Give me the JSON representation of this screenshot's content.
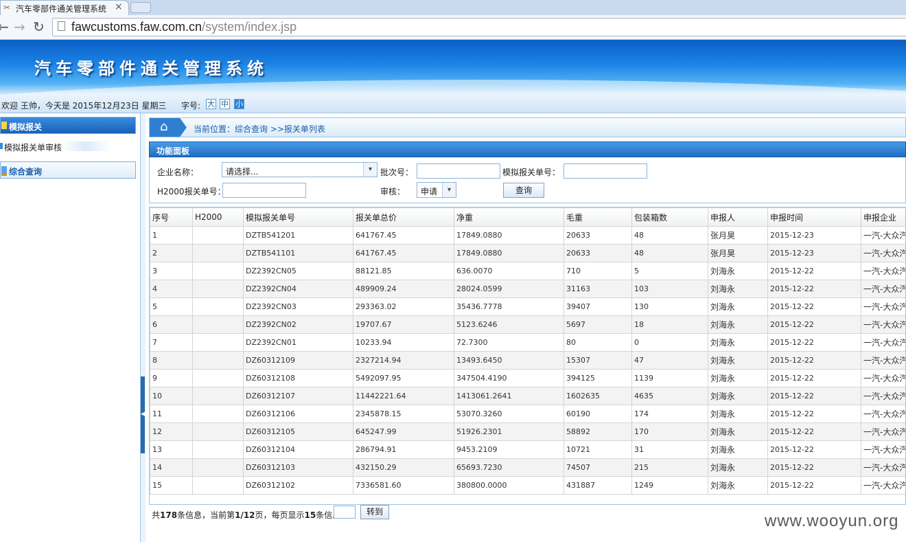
{
  "browser": {
    "tab_title": "汽车零部件通关管理系统",
    "tab_close": "×",
    "url_host": "fawcustoms.faw.com.cn",
    "url_path": "/system/index.jsp",
    "back_glyph": "←",
    "forward_glyph": "→",
    "reload_glyph": "↻"
  },
  "header": {
    "app_title": "汽车零部件通关管理系统",
    "welcome": "欢迎 王帅，今天是 2015年12月23日 星期三",
    "font_size_label": "字号:",
    "font_sizes": [
      "大",
      "中",
      "小"
    ]
  },
  "sidebar": {
    "sections": [
      {
        "label": "模拟报关",
        "items": [
          "模拟报关单审核"
        ]
      },
      {
        "label": "综合查询"
      }
    ]
  },
  "breadcrumb": {
    "text": "当前位置：综合查询 >>报关单列表",
    "home_glyph": "⌂"
  },
  "panel": {
    "title": "功能面板",
    "company_label": "企业名称：",
    "company_value": "请选择...",
    "batch_label": "批次号：",
    "batch_value": "",
    "mock_no_label": "模拟报关单号：",
    "mock_no_value": "",
    "h2000_label": "H2000报关单号：",
    "h2000_value": "",
    "audit_label": "审核：",
    "audit_value": "申请",
    "query_button": "查询",
    "dropdown_glyph": "▾"
  },
  "table": {
    "columns": [
      "序号",
      "H2000",
      "模拟报关单号",
      "报关单总价",
      "净重",
      "毛重",
      "包装箱数",
      "申报人",
      "申报时间",
      "申报企业"
    ],
    "rows": [
      [
        "1",
        "",
        "DZTB541201",
        "641767.45",
        "17849.0880",
        "20633",
        "48",
        "张月昊",
        "2015-12-23",
        "一汽-大众汽"
      ],
      [
        "2",
        "",
        "DZTB541101",
        "641767.45",
        "17849.0880",
        "20633",
        "48",
        "张月昊",
        "2015-12-23",
        "一汽-大众汽"
      ],
      [
        "3",
        "",
        "DZ2392CN05",
        "88121.85",
        "636.0070",
        "710",
        "5",
        "刘海永",
        "2015-12-22",
        "一汽-大众汽"
      ],
      [
        "4",
        "",
        "DZ2392CN04",
        "489909.24",
        "28024.0599",
        "31163",
        "103",
        "刘海永",
        "2015-12-22",
        "一汽-大众汽"
      ],
      [
        "5",
        "",
        "DZ2392CN03",
        "293363.02",
        "35436.7778",
        "39407",
        "130",
        "刘海永",
        "2015-12-22",
        "一汽-大众汽"
      ],
      [
        "6",
        "",
        "DZ2392CN02",
        "19707.67",
        "5123.6246",
        "5697",
        "18",
        "刘海永",
        "2015-12-22",
        "一汽-大众汽"
      ],
      [
        "7",
        "",
        "DZ2392CN01",
        "10233.94",
        "72.7300",
        "80",
        "0",
        "刘海永",
        "2015-12-22",
        "一汽-大众汽"
      ],
      [
        "8",
        "",
        "DZ60312109",
        "2327214.94",
        "13493.6450",
        "15307",
        "47",
        "刘海永",
        "2015-12-22",
        "一汽-大众汽"
      ],
      [
        "9",
        "",
        "DZ60312108",
        "5492097.95",
        "347504.4190",
        "394125",
        "1139",
        "刘海永",
        "2015-12-22",
        "一汽-大众汽"
      ],
      [
        "10",
        "",
        "DZ60312107",
        "11442221.64",
        "1413061.2641",
        "1602635",
        "4635",
        "刘海永",
        "2015-12-22",
        "一汽-大众汽"
      ],
      [
        "11",
        "",
        "DZ60312106",
        "2345878.15",
        "53070.3260",
        "60190",
        "174",
        "刘海永",
        "2015-12-22",
        "一汽-大众汽"
      ],
      [
        "12",
        "",
        "DZ60312105",
        "645247.99",
        "51926.2301",
        "58892",
        "170",
        "刘海永",
        "2015-12-22",
        "一汽-大众汽"
      ],
      [
        "13",
        "",
        "DZ60312104",
        "286794.91",
        "9453.2109",
        "10721",
        "31",
        "刘海永",
        "2015-12-22",
        "一汽-大众汽"
      ],
      [
        "14",
        "",
        "DZ60312103",
        "432150.29",
        "65693.7230",
        "74507",
        "215",
        "刘海永",
        "2015-12-22",
        "一汽-大众汽"
      ],
      [
        "15",
        "",
        "DZ60312102",
        "7336581.60",
        "380800.0000",
        "431887",
        "1249",
        "刘海永",
        "2015-12-22",
        "一汽-大众汽"
      ]
    ]
  },
  "pager": {
    "prefix": "共",
    "total": "178",
    "mid1": "条信息，当前第",
    "current": "1/12",
    "mid2": "页，每页显示",
    "per_page": "15",
    "suffix": "条信息",
    "page_input": "",
    "goto_button": "转到"
  },
  "watermark": "www.wooyun.org"
}
